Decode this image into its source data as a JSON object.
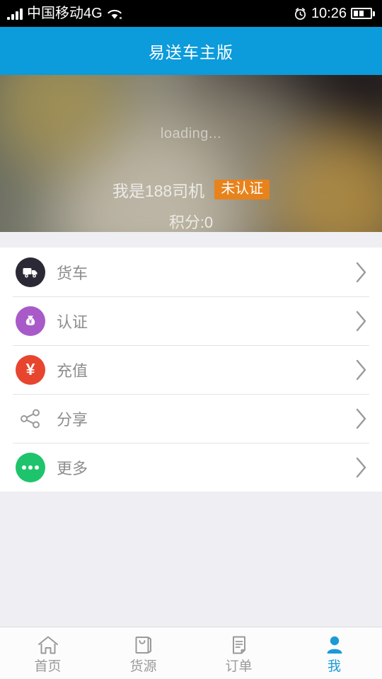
{
  "status_bar": {
    "carrier": "中国移动4G",
    "time": "10:26",
    "signal_icon": "signal-bars-icon",
    "wifi_icon": "wifi-icon",
    "alarm_icon": "alarm-clock-icon",
    "battery_icon": "battery-icon"
  },
  "header": {
    "title": "易送车主版",
    "accent_color": "#0c9bdb"
  },
  "profile": {
    "avatar_placeholder": "loading...",
    "username": "我是188司机",
    "verify_badge": "未认证",
    "verify_badge_color": "#e8831c",
    "points": "积分:0"
  },
  "menu": {
    "items": [
      {
        "label": "货车",
        "icon": "truck-icon",
        "color": "#2a2a36",
        "chevron": "chevron-right-icon"
      },
      {
        "label": "认证",
        "icon": "money-bag-icon",
        "color": "#a85ac8",
        "chevron": "chevron-right-icon"
      },
      {
        "label": "充值",
        "icon": "yen-circle-icon",
        "color": "#e8452f",
        "chevron": "chevron-right-icon"
      },
      {
        "label": "分享",
        "icon": "share-icon",
        "color": "#9a9a9a",
        "chevron": "chevron-right-icon"
      },
      {
        "label": "更多",
        "icon": "more-dots-icon",
        "color": "#1ec46b",
        "chevron": "chevron-right-icon"
      }
    ]
  },
  "tabbar": {
    "active_color": "#1a9ad7",
    "inactive_color": "#9a9a9a",
    "tabs": [
      {
        "label": "首页",
        "icon": "home-icon",
        "active": false
      },
      {
        "label": "货源",
        "icon": "bag-icon",
        "active": false
      },
      {
        "label": "订单",
        "icon": "document-icon",
        "active": false
      },
      {
        "label": "我",
        "icon": "person-icon",
        "active": true
      }
    ]
  }
}
